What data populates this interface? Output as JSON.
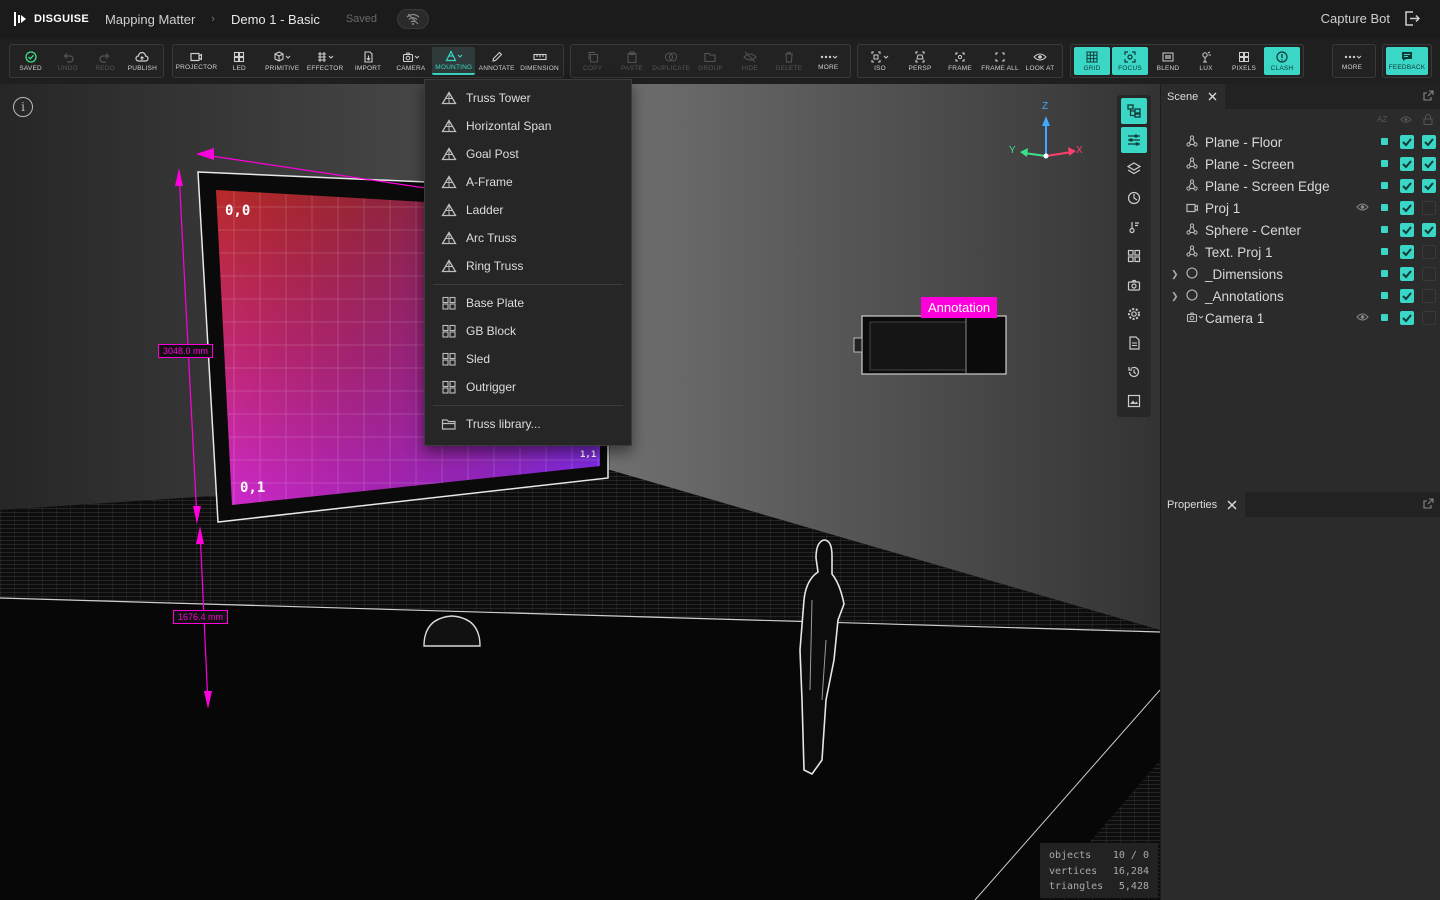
{
  "topbar": {
    "brand": "DISGUISE",
    "breadcrumb": [
      "Mapping Matter",
      "Demo 1 - Basic"
    ],
    "save_status": "Saved",
    "user": "Capture Bot"
  },
  "toolbar": {
    "group1": [
      {
        "label": "SAVED",
        "icon": "check-circle-icon"
      },
      {
        "label": "UNDO",
        "icon": "undo-icon",
        "disabled": true
      },
      {
        "label": "REDO",
        "icon": "redo-icon",
        "disabled": true
      },
      {
        "label": "PUBLISH",
        "icon": "cloud-upload-icon"
      }
    ],
    "group2": [
      {
        "label": "PROJECTOR",
        "icon": "projector-icon"
      },
      {
        "label": "LED",
        "icon": "led-icon"
      },
      {
        "label": "PRIMITIVE",
        "icon": "cube-icon"
      },
      {
        "label": "EFFECTOR",
        "icon": "effector-icon"
      },
      {
        "label": "IMPORT",
        "icon": "import-icon"
      },
      {
        "label": "CAMERA",
        "icon": "camera-icon"
      },
      {
        "label": "MOUNTING",
        "icon": "truss-icon",
        "active": true
      },
      {
        "label": "ANNOTATE",
        "icon": "pen-icon"
      },
      {
        "label": "DIMENSION",
        "icon": "ruler-icon"
      }
    ],
    "group3": [
      {
        "label": "COPY",
        "icon": "copy-icon"
      },
      {
        "label": "PASTE",
        "icon": "paste-icon"
      },
      {
        "label": "DUPLICATE",
        "icon": "duplicate-icon"
      },
      {
        "label": "GROUP",
        "icon": "folder-icon"
      },
      {
        "label": "HIDE",
        "icon": "eye-off-icon"
      },
      {
        "label": "DELETE",
        "icon": "trash-icon"
      }
    ],
    "group3_more": "MORE",
    "group4": [
      {
        "label": "ISO",
        "icon": "iso-icon"
      },
      {
        "label": "PERSP",
        "icon": "persp-icon"
      },
      {
        "label": "FRAME",
        "icon": "frame-icon"
      },
      {
        "label": "FRAME ALL",
        "icon": "frame-all-icon"
      },
      {
        "label": "LOOK AT",
        "icon": "look-at-icon"
      }
    ],
    "group5": [
      {
        "label": "GRID",
        "icon": "grid-icon",
        "state": "teal"
      },
      {
        "label": "FOCUS",
        "icon": "focus-icon",
        "state": "teal"
      },
      {
        "label": "BLEND",
        "icon": "blend-icon"
      },
      {
        "label": "LUX",
        "icon": "lux-icon"
      },
      {
        "label": "PIXELS",
        "icon": "pixels-icon"
      },
      {
        "label": "CLASH",
        "icon": "clash-icon",
        "state": "teal"
      }
    ],
    "more_label": "MORE",
    "feedback_label": "FEEDBACK"
  },
  "mounting_menu": {
    "truss_items": [
      "Truss Tower",
      "Horizontal Span",
      "Goal Post",
      "A-Frame",
      "Ladder",
      "Arc Truss",
      "Ring Truss"
    ],
    "base_items": [
      "Base Plate",
      "GB Block",
      "Sled",
      "Outrigger"
    ],
    "library": "Truss library..."
  },
  "viewport": {
    "dim_vertical": "3048.0 mm",
    "dim_floor": "1676.4 mm",
    "annotation": "Annotation",
    "axes": {
      "z": "Z",
      "y": "Y",
      "x": "X"
    },
    "screen_corners": {
      "top_left": "0,0",
      "bottom_left": "0,1",
      "bottom_right": "1,1"
    },
    "stats": [
      {
        "label": "objects",
        "value": "10 / 0"
      },
      {
        "label": "vertices",
        "value": "16,284"
      },
      {
        "label": "triangles",
        "value": "5,428"
      }
    ],
    "accent_magenta": "#ff00dc",
    "accent_teal": "#3ad6c6"
  },
  "scene_panel": {
    "title": "Scene",
    "sort_label": "AZ",
    "items": [
      {
        "name": "Plane - Floor",
        "icon": "mesh-icon",
        "vis": true,
        "lock": true
      },
      {
        "name": "Plane - Screen",
        "icon": "mesh-icon",
        "vis": true,
        "lock": true
      },
      {
        "name": "Plane - Screen Edge",
        "icon": "mesh-icon",
        "vis": true,
        "lock": true
      },
      {
        "name": "Proj 1",
        "icon": "projector-icon",
        "eye": true,
        "vis": true,
        "lock": false
      },
      {
        "name": "Sphere - Center",
        "icon": "mesh-icon",
        "vis": true,
        "lock": true
      },
      {
        "name": "Text. Proj 1",
        "icon": "mesh-icon",
        "vis": true,
        "lock": false
      },
      {
        "name": "_Dimensions",
        "icon": "group-icon",
        "expand": true,
        "vis": true,
        "lock": false
      },
      {
        "name": "_Annotations",
        "icon": "group-icon",
        "expand": true,
        "vis": true,
        "lock": false
      },
      {
        "name": "Camera 1",
        "icon": "camera-icon",
        "eye": true,
        "vis": true,
        "lock": false
      }
    ]
  },
  "properties_panel": {
    "title": "Properties"
  }
}
